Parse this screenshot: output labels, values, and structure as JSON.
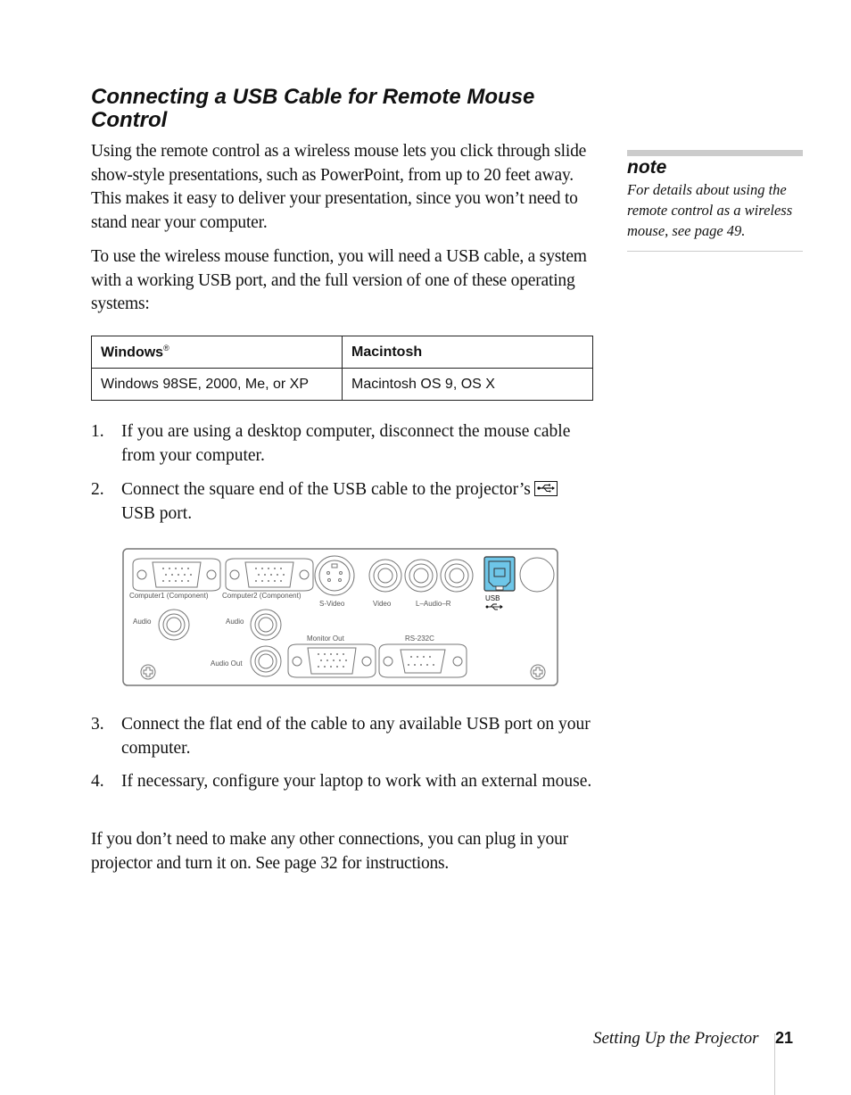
{
  "section": {
    "heading": "Connecting a USB Cable for Remote Mouse Control",
    "paragraphs": [
      "Using the remote control as a wireless mouse lets you click through slide show-style presentations, such as PowerPoint, from up to 20 feet away. This makes it easy to deliver your presentation, since you won’t need to stand near your computer.",
      "To use the wireless mouse function, you will need a USB cable, a system with a working USB port, and the full version of one of these operating systems:"
    ],
    "closing": "If you don’t need to make any other connections, you can plug in your projector and turn it on. See page 32 for instructions."
  },
  "os_table": {
    "headers": [
      "Windows",
      "Macintosh"
    ],
    "registered_mark": "®",
    "rows": [
      [
        "Windows 98SE, 2000, Me, or XP",
        "Macintosh OS 9, OS X"
      ]
    ]
  },
  "steps": [
    {
      "num": "1.",
      "text": "If you are using a desktop computer, disconnect the mouse cable from your computer."
    },
    {
      "num": "2.",
      "text_before": "Connect the square end of the USB cable to the projector’s",
      "icon": "usb-icon",
      "text_after": "USB port."
    },
    {
      "num": "3.",
      "text": "Connect the flat end of the cable to any available USB port on your computer."
    },
    {
      "num": "4.",
      "text": "If necessary, configure your laptop to work with an external mouse."
    }
  ],
  "panel_labels": {
    "computer1": "Computer1 (Component)",
    "computer2": "Computer2 (Component)",
    "svideo": "S-Video",
    "video": "Video",
    "laudior": "L–Audio–R",
    "usb": "USB",
    "audio1": "Audio",
    "audio2": "Audio",
    "audio_out": "Audio Out",
    "monitor_out": "Monitor Out",
    "rs232c": "RS-232C",
    "highlight_color": "#6ec6e8"
  },
  "note": {
    "title": "note",
    "text": "For details about using the remote control as a wireless mouse, see page 49."
  },
  "footer": {
    "chapter": "Setting Up the Projector",
    "page": "21"
  }
}
